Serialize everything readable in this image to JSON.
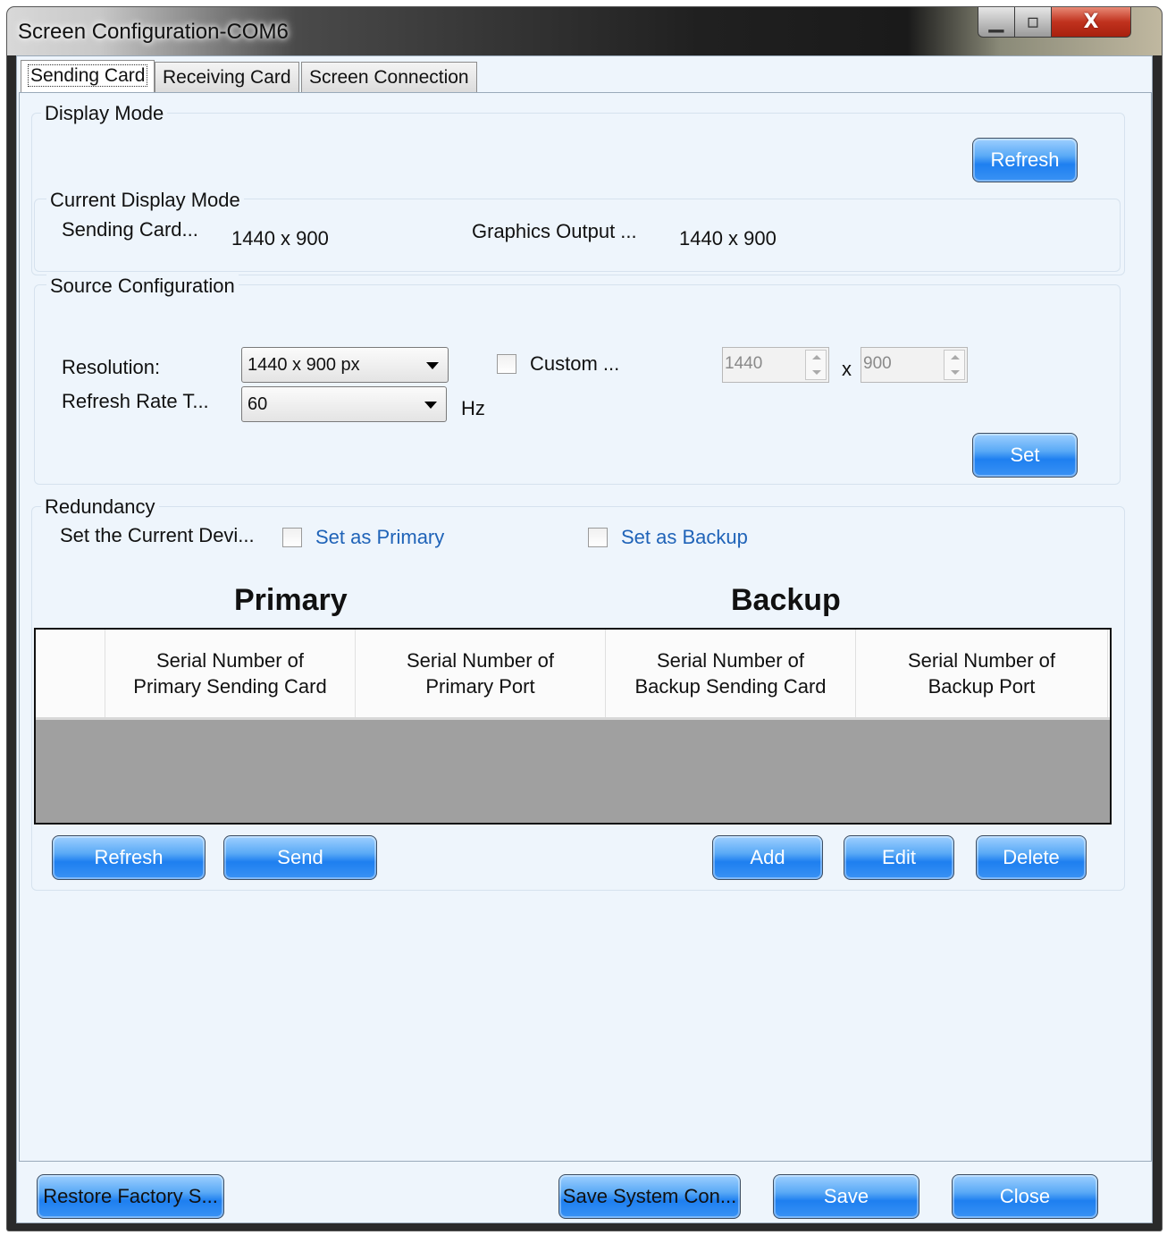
{
  "window": {
    "title": "Screen Configuration-COM6",
    "min_glyph": "▁",
    "max_glyph": "▫",
    "close_glyph": "X"
  },
  "tabs": [
    "Sending Card",
    "Receiving Card",
    "Screen Connection"
  ],
  "display_mode": {
    "group_label": "Display Mode",
    "refresh_label": "Refresh",
    "current": {
      "group_label": "Current Display Mode",
      "sending_card_label": "Sending Card...",
      "sending_card_value": "1440 x 900",
      "graphics_output_label": "Graphics Output ...",
      "graphics_output_value": "1440 x 900"
    }
  },
  "source_config": {
    "group_label": "Source Configuration",
    "resolution_label": "Resolution:",
    "resolution_value": "1440 x 900 px",
    "refresh_rate_label": "Refresh Rate T...",
    "refresh_rate_value": "60",
    "hz_label": "Hz",
    "custom_label": "Custom ...",
    "custom_checked": false,
    "custom_width": "1440",
    "custom_x": "x",
    "custom_height": "900",
    "set_label": "Set"
  },
  "redundancy": {
    "group_label": "Redundancy",
    "set_current_label": "Set the Current Devi...",
    "set_primary_label": "Set as Primary",
    "set_backup_label": "Set as Backup",
    "primary_heading": "Primary",
    "backup_heading": "Backup",
    "columns": [
      "Serial Number of Primary Sending Card",
      "Serial Number of Primary Port",
      "Serial Number of Backup Sending Card",
      "Serial Number of Backup Port"
    ],
    "rows": [],
    "buttons": {
      "refresh": "Refresh",
      "send": "Send",
      "add": "Add",
      "edit": "Edit",
      "delete": "Delete"
    }
  },
  "footer": {
    "restore": "Restore Factory S...",
    "save_system": "Save System Con...",
    "save": "Save",
    "close": "Close"
  },
  "colors": {
    "accent_button": "#1e7ff0",
    "link": "#1f63b8",
    "panel_bg": "#eef5fc",
    "close_red": "#c0321e"
  }
}
